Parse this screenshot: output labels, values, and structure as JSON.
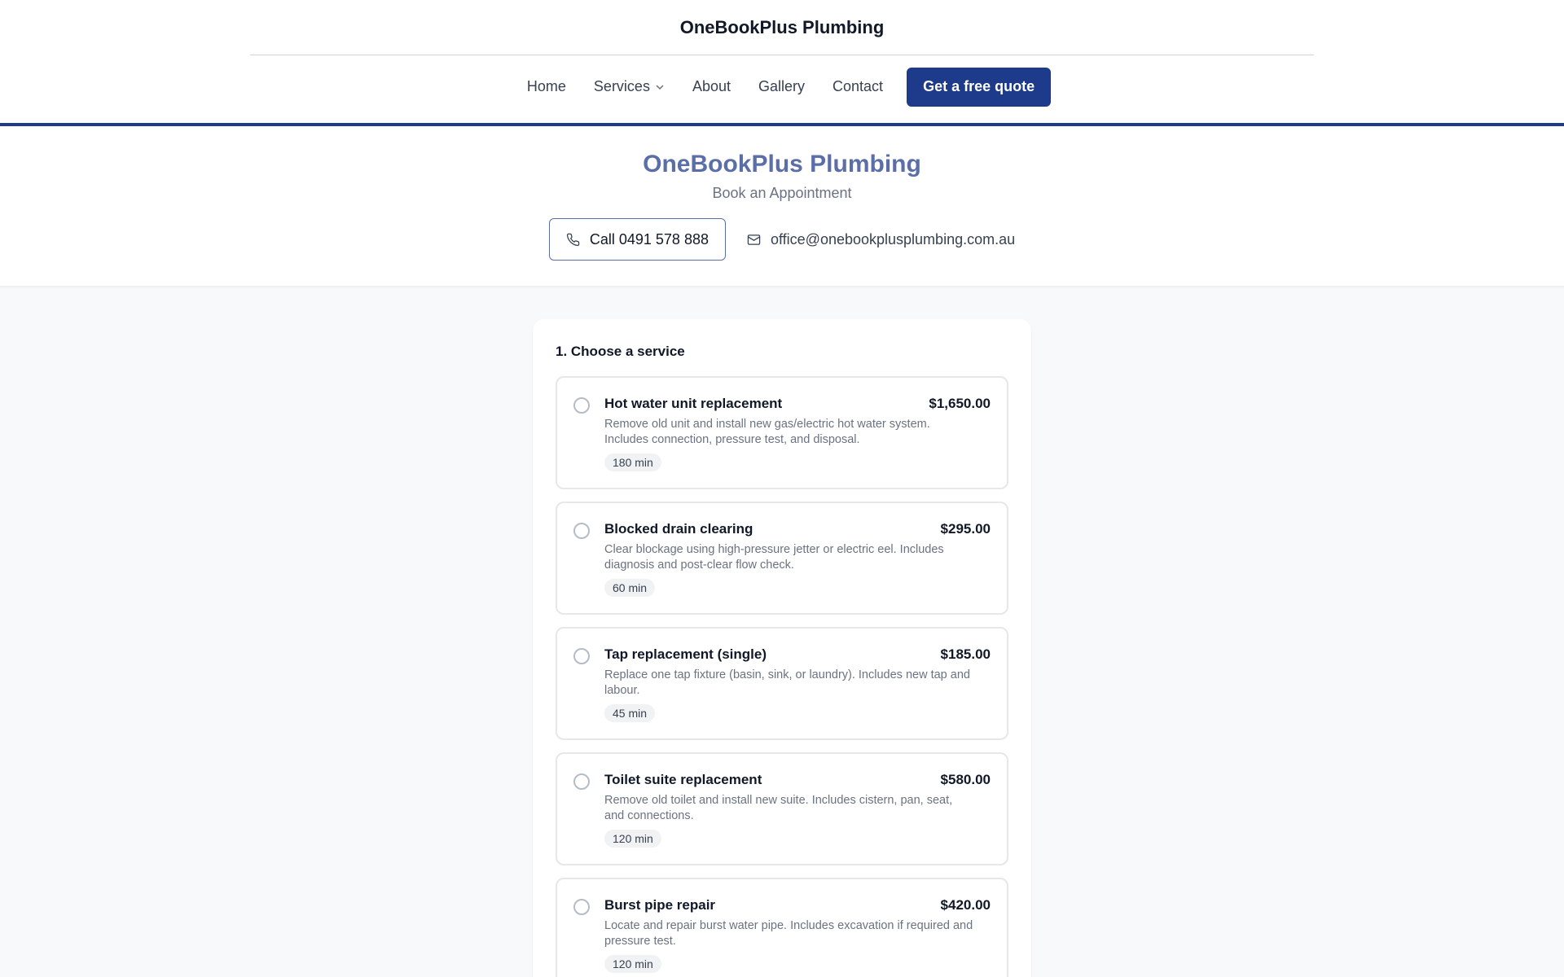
{
  "brand": {
    "name": "OneBookPlus Plumbing"
  },
  "nav": {
    "items": [
      {
        "label": "Home"
      },
      {
        "label": "Services"
      },
      {
        "label": "About"
      },
      {
        "label": "Gallery"
      },
      {
        "label": "Contact"
      }
    ],
    "cta_label": "Get a free quote"
  },
  "hero": {
    "title": "OneBookPlus Plumbing",
    "subtitle": "Book an Appointment",
    "call_label": "Call 0491 578 888",
    "email": "office@onebookplusplumbing.com.au"
  },
  "booking": {
    "step_title": "1. Choose a service",
    "services": [
      {
        "name": "Hot water unit replacement",
        "price": "$1,650.00",
        "description": "Remove old unit and install new gas/electric hot water system. Includes connection, pressure test, and disposal.",
        "duration": "180 min"
      },
      {
        "name": "Blocked drain clearing",
        "price": "$295.00",
        "description": "Clear blockage using high-pressure jetter or electric eel. Includes diagnosis and post-clear flow check.",
        "duration": "60 min"
      },
      {
        "name": "Tap replacement (single)",
        "price": "$185.00",
        "description": "Replace one tap fixture (basin, sink, or laundry). Includes new tap and labour.",
        "duration": "45 min"
      },
      {
        "name": "Toilet suite replacement",
        "price": "$580.00",
        "description": "Remove old toilet and install new suite. Includes cistern, pan, seat, and connections.",
        "duration": "120 min"
      },
      {
        "name": "Burst pipe repair",
        "price": "$420.00",
        "description": "Locate and repair burst water pipe. Includes excavation if required and pressure test.",
        "duration": "120 min"
      }
    ]
  },
  "colors": {
    "primary": "#1e3a8a",
    "accent_title": "#5b6ea8"
  }
}
